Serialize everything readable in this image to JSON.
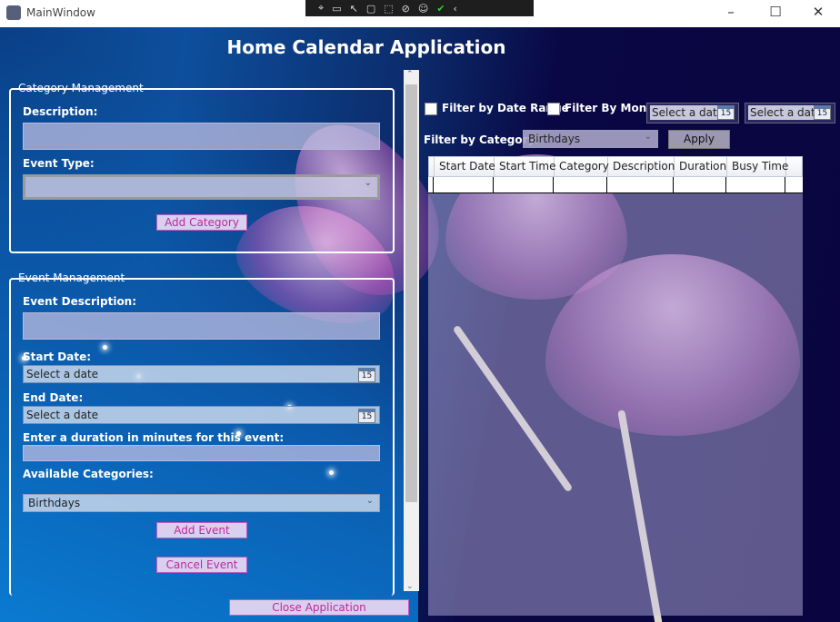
{
  "window": {
    "title": "MainWindow",
    "minimize": "–",
    "maximize": "☐",
    "close": "✕"
  },
  "debug_toolbar": {
    "icons": [
      "select-element",
      "camera",
      "pointer",
      "square",
      "track-focus",
      "hot-reload",
      "accessibility",
      "check"
    ]
  },
  "header": {
    "title": "Home Calendar Application"
  },
  "category_management": {
    "legend": "Category Management",
    "description_label": "Description:",
    "description_value": "",
    "event_type_label": "Event Type:",
    "event_type_value": "",
    "add_button": "Add Category"
  },
  "event_management": {
    "legend": "Event Management",
    "description_label": "Event Description:",
    "description_value": "",
    "start_label": "Start Date:",
    "start_placeholder": "Select a date",
    "end_label": "End Date:",
    "end_placeholder": "Select a date",
    "duration_label": "Enter a duration in minutes for this event:",
    "duration_value": "",
    "categories_label": "Available Categories:",
    "category_value": "Birthdays",
    "add_button": "Add Event",
    "cancel_button": "Cancel Event"
  },
  "close_button": "Close Application",
  "filters": {
    "date_range_label": "Filter by Date Range",
    "month_label": "Filter By Month",
    "date1_placeholder": "Select a date",
    "date2_placeholder": "Select a date",
    "calendar_day": "15",
    "category_label": "Filter by Category:",
    "category_value": "Birthdays",
    "apply_button": "Apply Filters"
  },
  "grid": {
    "columns": [
      "Start Date",
      "Start Time",
      "Category",
      "Description",
      "Duration",
      "Busy Time"
    ],
    "rows": [
      [
        "",
        "",
        "",
        "",
        "",
        ""
      ]
    ]
  }
}
